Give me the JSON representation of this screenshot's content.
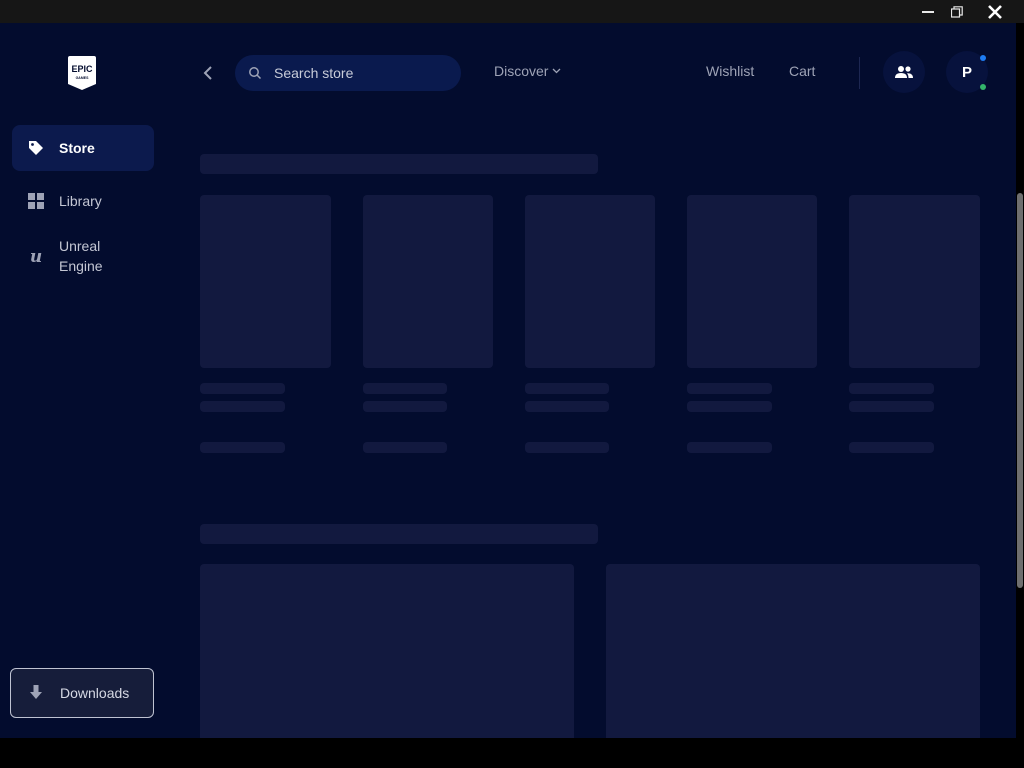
{
  "window": {
    "controls": [
      "minimize",
      "restore",
      "close"
    ]
  },
  "sidebar": {
    "logo_text": "EPIC GAMES",
    "items": [
      {
        "label": "Store",
        "icon": "tag-icon",
        "active": true
      },
      {
        "label": "Library",
        "icon": "grid-icon",
        "active": false
      },
      {
        "label": "Unreal Engine",
        "icon": "unreal-icon",
        "active": false
      }
    ],
    "downloads_label": "Downloads"
  },
  "topbar": {
    "search_placeholder": "Search store",
    "discover_label": "Discover",
    "wishlist_label": "Wishlist",
    "cart_label": "Cart",
    "avatar_initial": "P"
  },
  "colors": {
    "background": "#030c2e",
    "sidebar_active": "#0c1a4d",
    "skeleton": "#12193f",
    "notification_dot": "#1e7cf2",
    "online_dot": "#33b56a"
  }
}
